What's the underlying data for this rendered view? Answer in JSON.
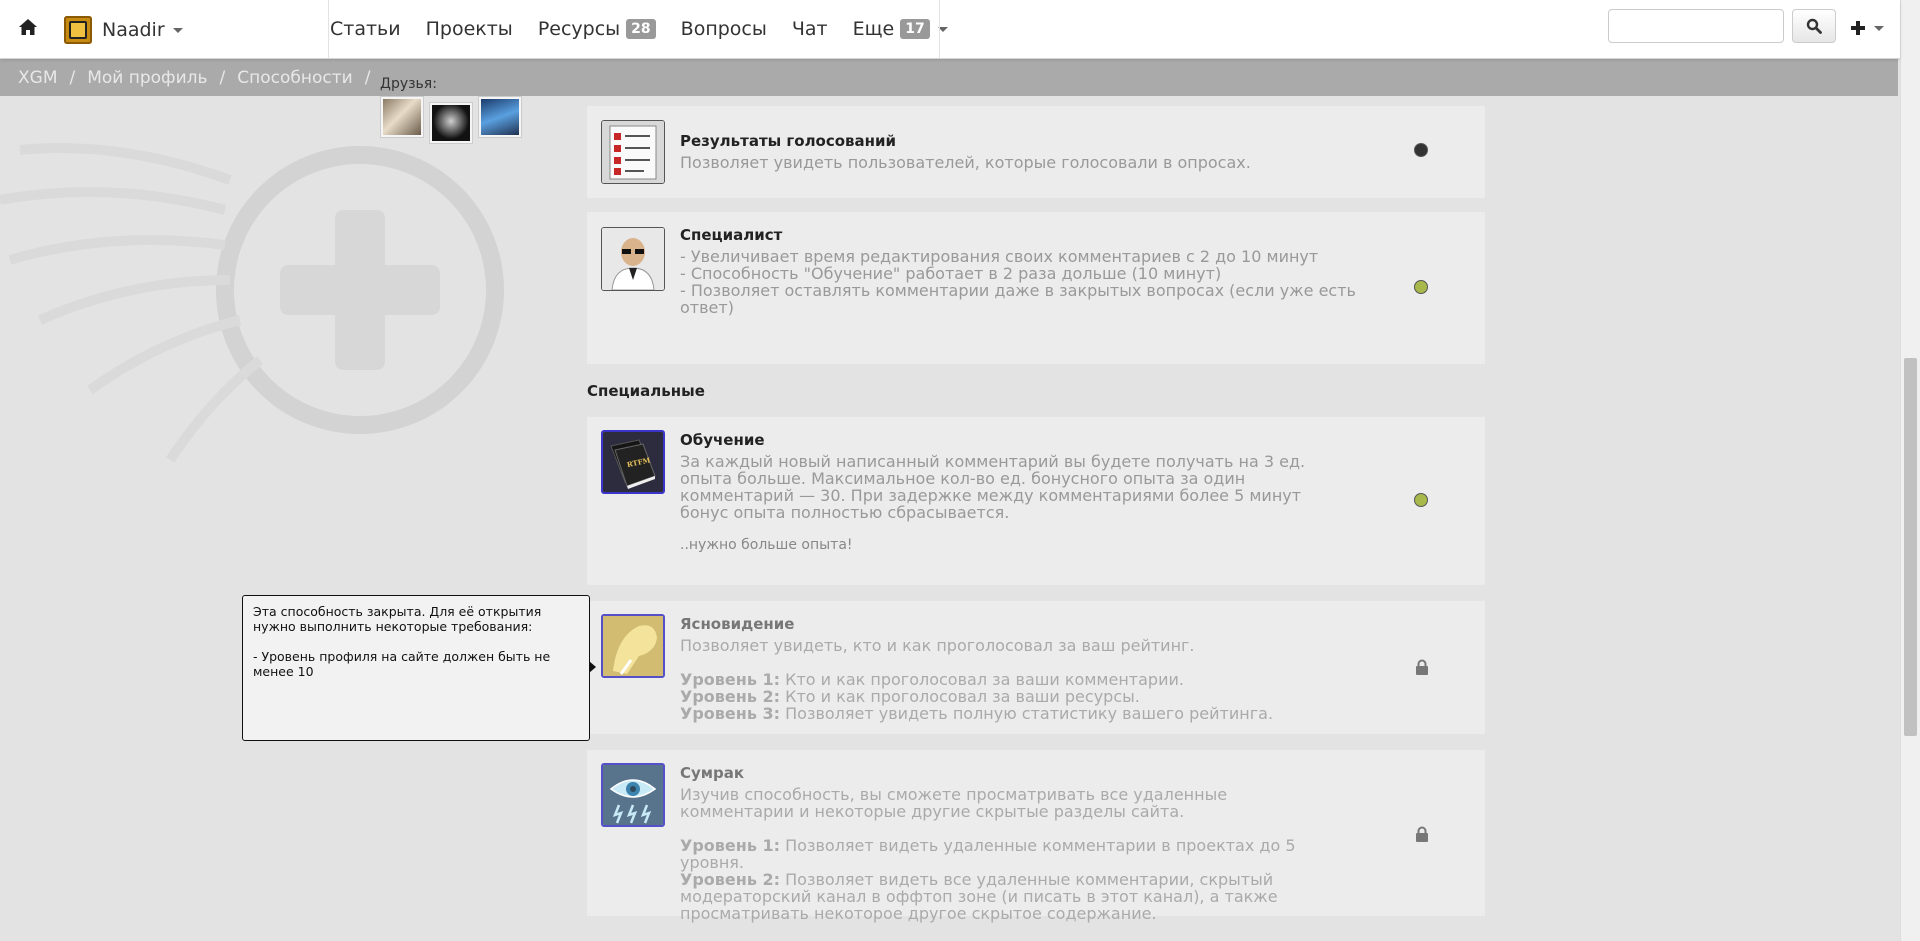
{
  "nav": {
    "username": "Naadir",
    "menu": [
      {
        "label": "Статьи"
      },
      {
        "label": "Проекты"
      },
      {
        "label": "Ресурсы",
        "badge": "28"
      },
      {
        "label": "Вопросы"
      },
      {
        "label": "Чат"
      },
      {
        "label": "Еще",
        "badge": "17"
      }
    ],
    "search_value": "",
    "icons": [
      "home-icon",
      "search-icon",
      "plus-icon",
      "chevron-down-icon"
    ]
  },
  "breadcrumb": {
    "items": [
      "XGM",
      "Мой профиль",
      "Способности"
    ],
    "separator": "/"
  },
  "friends": {
    "label": "Друзья:"
  },
  "sections": {
    "special": "Специальные"
  },
  "abilities": [
    {
      "title": "Результаты голосований",
      "desc": "Позволяет увидеть пользователей, которые голосовали в опросах.",
      "status": "owned",
      "status_color": "#333333",
      "icon": "poll-results-icon"
    },
    {
      "title": "Специалист",
      "lines": [
        "- Увеличивает время редактирования своих комментариев с 2 до 10 минут",
        "- Способность \"Обучение\" работает в 2 раза дольше (10 минут)",
        "- Позволяет оставлять комментарии даже в закрытых вопросах (если уже есть ответ)"
      ],
      "status": "available",
      "status_color": "#a8b84a",
      "icon": "specialist-icon"
    },
    {
      "title": "Обучение",
      "desc": "За каждый новый написанный комментарий вы будете получать на 3 ед. опыта больше. Максимальное кол-во ед. бонусного опыта за один комментарий — 30. При задержке между комментариями более 5 минут бонус опыта полностью сбрасывается.",
      "note": "..нужно больше опыта!",
      "status": "available",
      "status_color": "#a8b84a",
      "icon": "rtfm-book-icon"
    },
    {
      "title": "Ясновидение",
      "desc": "Позволяет увидеть, кто и как проголосовал за ваш рейтинг.",
      "levels": [
        {
          "label": "Уровень 1:",
          "text": "Кто и как проголосовал за ваши комментарии."
        },
        {
          "label": "Уровень 2:",
          "text": "Кто и как проголосовал за ваши ресурсы."
        },
        {
          "label": "Уровень 3:",
          "text": "Позволяет увидеть полную статистику вашего рейтинга."
        }
      ],
      "status": "locked",
      "icon": "clairvoyance-icon"
    },
    {
      "title": "Сумрак",
      "desc": "Изучив способность, вы сможете просматривать все удаленные комментарии и некоторые другие скрытые разделы сайта.",
      "levels": [
        {
          "label": "Уровень 1:",
          "text": "Позволяет видеть удаленные комментарии в проектах до 5 уровня."
        },
        {
          "label": "Уровень 2:",
          "text": "Позволяет видеть все удаленные комментарии, скрытый модераторский канал в оффтоп зоне (и писать в этот канал), а также просматривать некоторое другое скрытое содержание."
        }
      ],
      "status": "locked",
      "icon": "twilight-eye-icon"
    }
  ],
  "tooltip": {
    "line1": "Эта способность закрыта. Для её открытия нужно выполнить некоторые требования:",
    "line2": "- Уровень профиля на сайте должен быть не менее 10"
  }
}
